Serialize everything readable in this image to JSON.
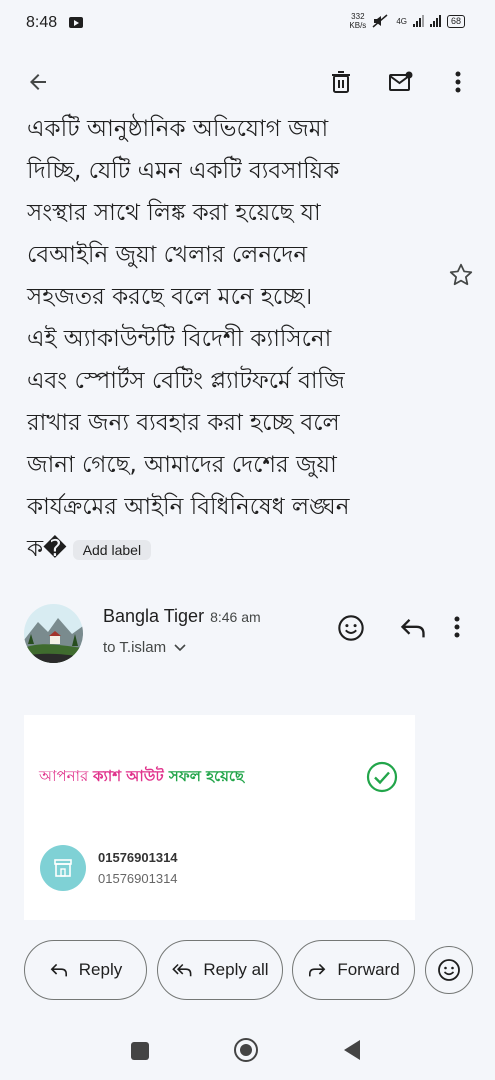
{
  "status_bar": {
    "time": "8:48",
    "net_speed_top": "332",
    "net_speed_unit": "KB/s",
    "network_type": "4G",
    "battery": "68"
  },
  "toolbar": {
    "back_icon": "arrow-left-icon",
    "delete_icon": "trash-icon",
    "mail_icon": "mark-unread-icon",
    "more_icon": "more-vert-icon"
  },
  "message": {
    "lines": [
      "একটি আনুষ্ঠানিক অভিযোগ জমা",
      "দিচ্ছি, যেটি এমন একটি ব্যবসায়িক",
      "সংস্থার সাথে লিঙ্ক করা হয়েছে যা",
      "বেআইনি জুয়া খেলার লেনদেন",
      "সহজতর করছে বলে মনে হচ্ছে।",
      "এই অ্যাকাউন্টটি বিদেশী ক্যাসিনো",
      "এবং স্পোর্টস বেটিং প্ল্যাটফর্মে বাজি",
      "রাখার জন্য ব্যবহার করা হচ্ছে বলে",
      "জানা গেছে, আমাদের দেশের জুয়া",
      "কার্যক্রমের আইনি বিধিনিষেধ লঙ্ঘন"
    ],
    "last_line": "ক�",
    "add_label": "Add label"
  },
  "sender": {
    "name": "Bangla Tiger",
    "time": "8:46 am",
    "to": "to T.islam"
  },
  "card": {
    "msg_part1": "আপনার ",
    "msg_part2": "ক্যাশ আউট ",
    "msg_part3": "সফল হয়েছে",
    "number_primary": "01576901314",
    "number_secondary": "01576901314",
    "colors": {
      "pink": "#e0338c",
      "green": "#22a54a",
      "teal": "#7fd1d5"
    }
  },
  "actions": {
    "reply": "Reply",
    "reply_all": "Reply all",
    "forward": "Forward"
  }
}
